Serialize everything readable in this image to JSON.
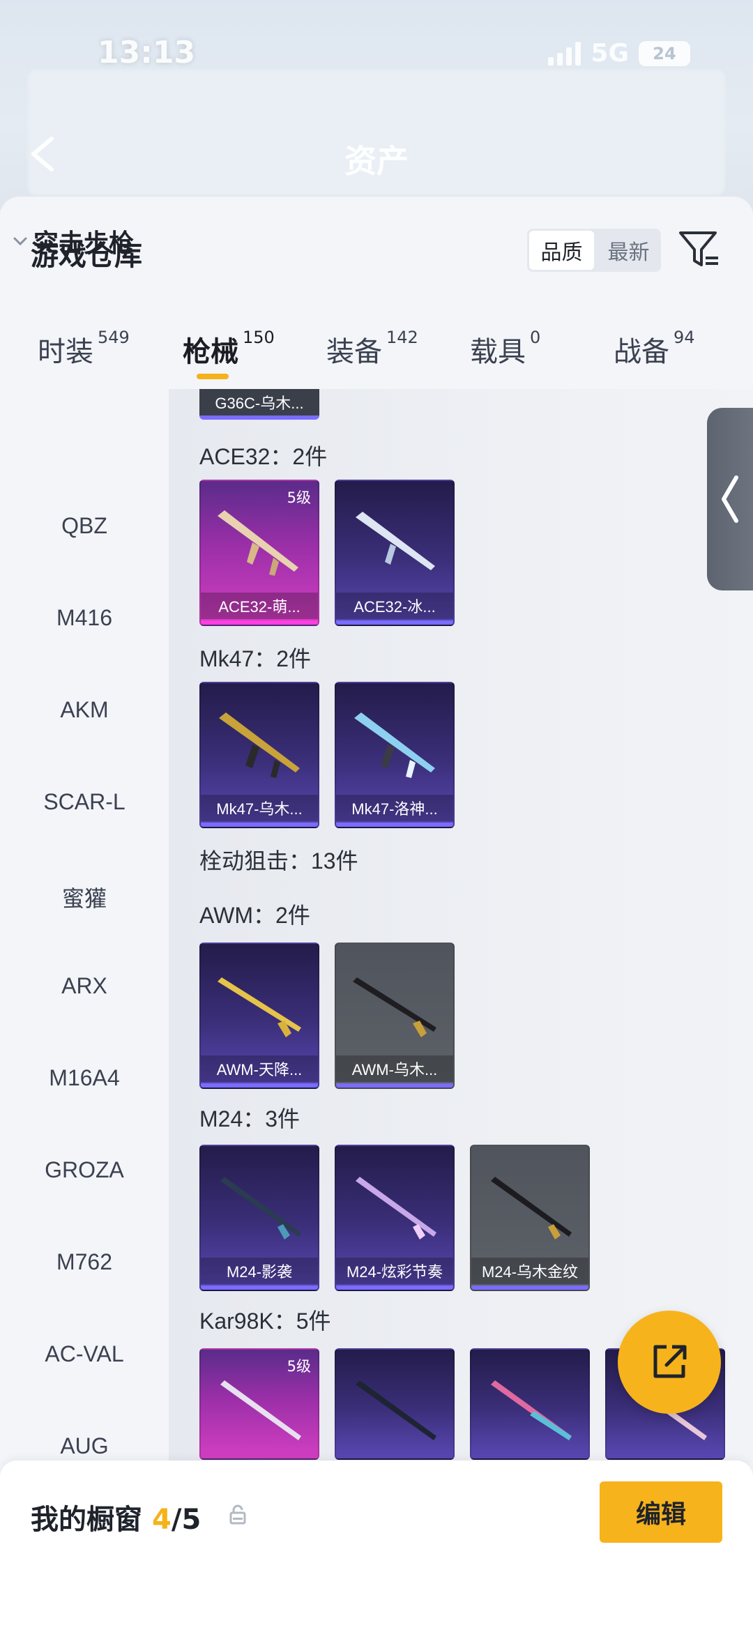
{
  "status_bar": {
    "time": "13:13",
    "network": "5G",
    "battery": "24"
  },
  "header": {
    "title": "资产"
  },
  "sheet": {
    "title": "游戏仓库",
    "sort": {
      "options": [
        "品质",
        "最新"
      ],
      "active": "品质"
    }
  },
  "tabs": [
    {
      "label": "时装",
      "count": "549"
    },
    {
      "label": "枪械",
      "count": "150",
      "active": true
    },
    {
      "label": "装备",
      "count": "142"
    },
    {
      "label": "载具",
      "count": "0"
    },
    {
      "label": "战备",
      "count": "94"
    }
  ],
  "categories": {
    "header": "突击步枪",
    "items": [
      "QBZ",
      "M416",
      "AKM",
      "SCAR-L",
      "蜜獾",
      "ARX",
      "M16A4",
      "GROZA",
      "M762",
      "AC-VAL",
      "AUG"
    ]
  },
  "content": {
    "top_partial": "G36C-乌木...",
    "groups": [
      {
        "label": "ACE32：2件",
        "cards": [
          {
            "name": "ACE32-萌...",
            "rarity": "pink",
            "level": "5级"
          },
          {
            "name": "ACE32-冰...",
            "rarity": "purple"
          }
        ]
      },
      {
        "label": "Mk47：2件",
        "cards": [
          {
            "name": "Mk47-乌木...",
            "rarity": "purple"
          },
          {
            "name": "Mk47-洛神...",
            "rarity": "purple"
          }
        ]
      },
      {
        "label": "栓动狙击：13件",
        "cards": []
      },
      {
        "label": "AWM：2件",
        "cards": [
          {
            "name": "AWM-天降...",
            "rarity": "purple"
          },
          {
            "name": "AWM-乌木...",
            "rarity": "gray"
          }
        ]
      },
      {
        "label": "M24：3件",
        "cards": [
          {
            "name": "M24-影袭",
            "rarity": "purple"
          },
          {
            "name": "M24-炫彩节奏",
            "rarity": "purple"
          },
          {
            "name": "M24-乌木金纹",
            "rarity": "gray"
          }
        ]
      },
      {
        "label": "Kar98K：5件",
        "cards": [
          {
            "name": "",
            "rarity": "pink",
            "level": "5级"
          },
          {
            "name": "",
            "rarity": "purple"
          },
          {
            "name": "",
            "rarity": "purple"
          },
          {
            "name": "",
            "rarity": "purple"
          }
        ]
      }
    ]
  },
  "showcase": {
    "label": "我的橱窗",
    "count": "4",
    "total": "/5",
    "edit_label": "编辑"
  },
  "colors": {
    "accent": "#f7b31b",
    "rare_pink": "#ff3fe0",
    "rare_purple": "#7a6cff"
  }
}
